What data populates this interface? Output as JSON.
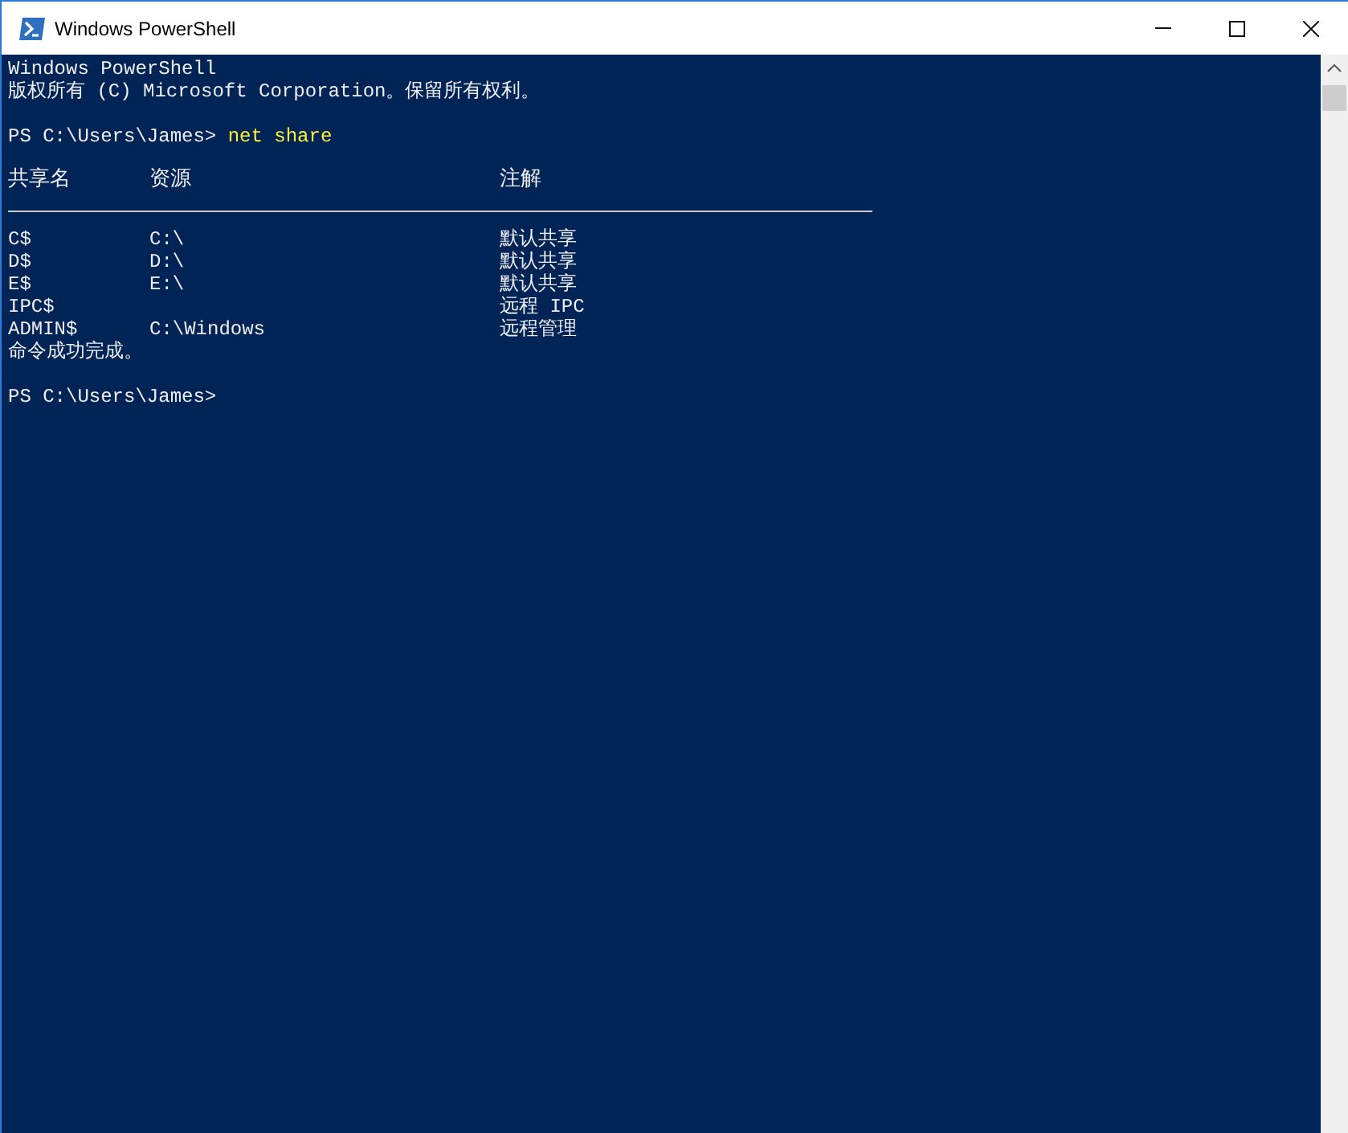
{
  "window": {
    "title": "Windows PowerShell"
  },
  "console": {
    "banner": [
      "Windows PowerShell",
      "版权所有 (C) Microsoft Corporation。保留所有权利。"
    ],
    "prompt": "PS C:\\Users\\James>",
    "command": "net share",
    "table": {
      "columns": [
        "共享名",
        "资源",
        "注解"
      ],
      "rows": [
        [
          "C$",
          "C:\\",
          "默认共享"
        ],
        [
          "D$",
          "D:\\",
          "默认共享"
        ],
        [
          "E$",
          "E:\\",
          "默认共享"
        ],
        [
          "IPC$",
          "",
          "远程 IPC"
        ],
        [
          "ADMIN$",
          "C:\\Windows",
          "远程管理"
        ]
      ]
    },
    "result": "命令成功完成。",
    "final_prompt": "PS C:\\Users\\James>"
  }
}
